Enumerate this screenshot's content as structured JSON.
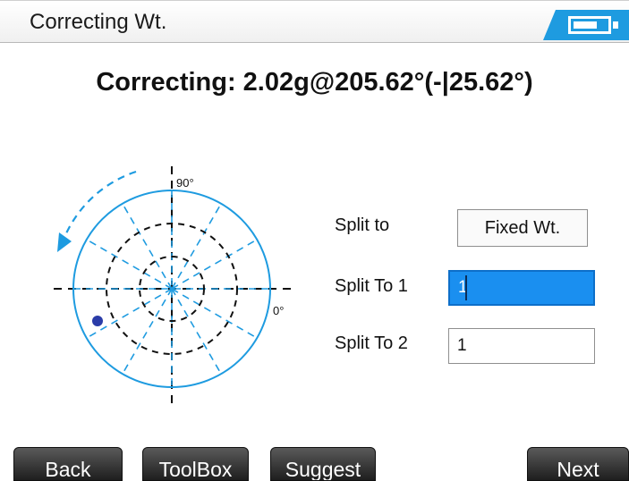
{
  "header": {
    "title": "Correcting Wt.",
    "battery_icon": "battery-icon",
    "accent_color": "#1e9be0"
  },
  "headline": "Correcting: 2.02g@205.62°(-|25.62°)",
  "polar": {
    "label_90": "90°",
    "label_0": "0°",
    "marker_color": "#2a3ca8",
    "circle_color": "#1e9be0"
  },
  "split": {
    "split_to_label": "Split to",
    "fixed_wt_label": "Fixed Wt.",
    "split_to_1_label": "Split To 1",
    "split_to_1_value": "1",
    "split_to_2_label": "Split To 2",
    "split_to_2_value": "1"
  },
  "footer": {
    "back_label": "Back",
    "toolbox_label": "ToolBox",
    "suggest_label": "Suggest",
    "next_label": "Next"
  }
}
